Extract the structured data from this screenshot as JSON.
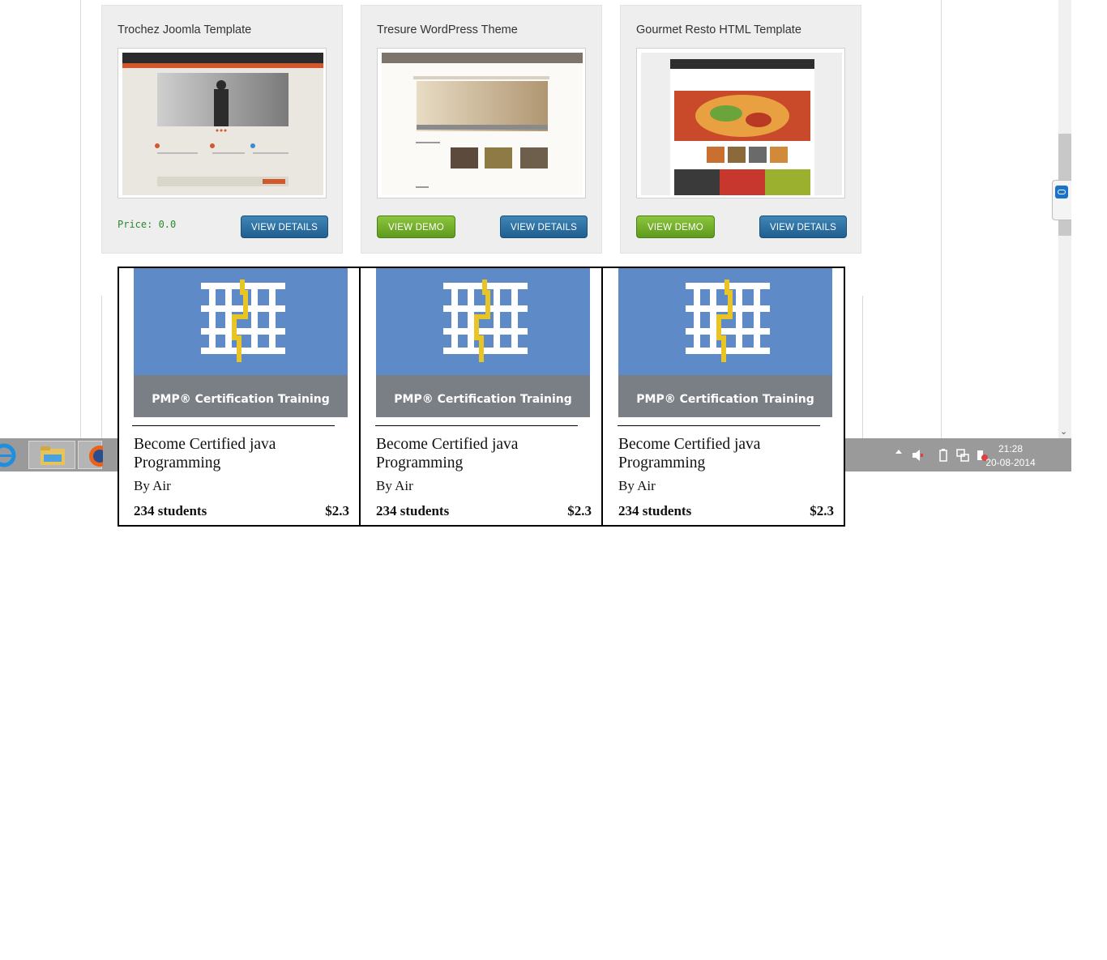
{
  "templates": [
    {
      "title": "Trochez Joomla Template",
      "price": "Price: 0.0",
      "demo_label": "",
      "details_label": "VIEW DETAILS"
    },
    {
      "title": "Tresure WordPress Theme",
      "price": "",
      "demo_label": "VIEW DEMO",
      "details_label": "VIEW DETAILS"
    },
    {
      "title": "Gourmet Resto HTML Template",
      "price": "",
      "demo_label": "VIEW DEMO",
      "details_label": "VIEW DETAILS"
    }
  ],
  "courses": [
    {
      "banner": "PMP® Certification Training",
      "title": "Become Certified java Programming",
      "author": "By Air",
      "students": "234 students",
      "price": "$2.3"
    },
    {
      "banner": "PMP® Certification Training",
      "title": "Become Certified java Programming",
      "author": "By Air",
      "students": "234 students",
      "price": "$2.3"
    },
    {
      "banner": "PMP® Certification Training",
      "title": "Become Certified java Programming",
      "author": "By Air",
      "students": "234 students",
      "price": "$2.3"
    }
  ],
  "taskbar": {
    "apps": [
      "internet-explorer-icon",
      "file-explorer-icon",
      "firefox-icon"
    ],
    "clock_time": "21:28",
    "clock_date": "20-08-2014"
  },
  "colors": {
    "btn_blue": "#2f6f9f",
    "btn_green": "#74ad2c",
    "course_banner": "#5e8bc7",
    "course_banner_footer": "#7a7f86"
  }
}
